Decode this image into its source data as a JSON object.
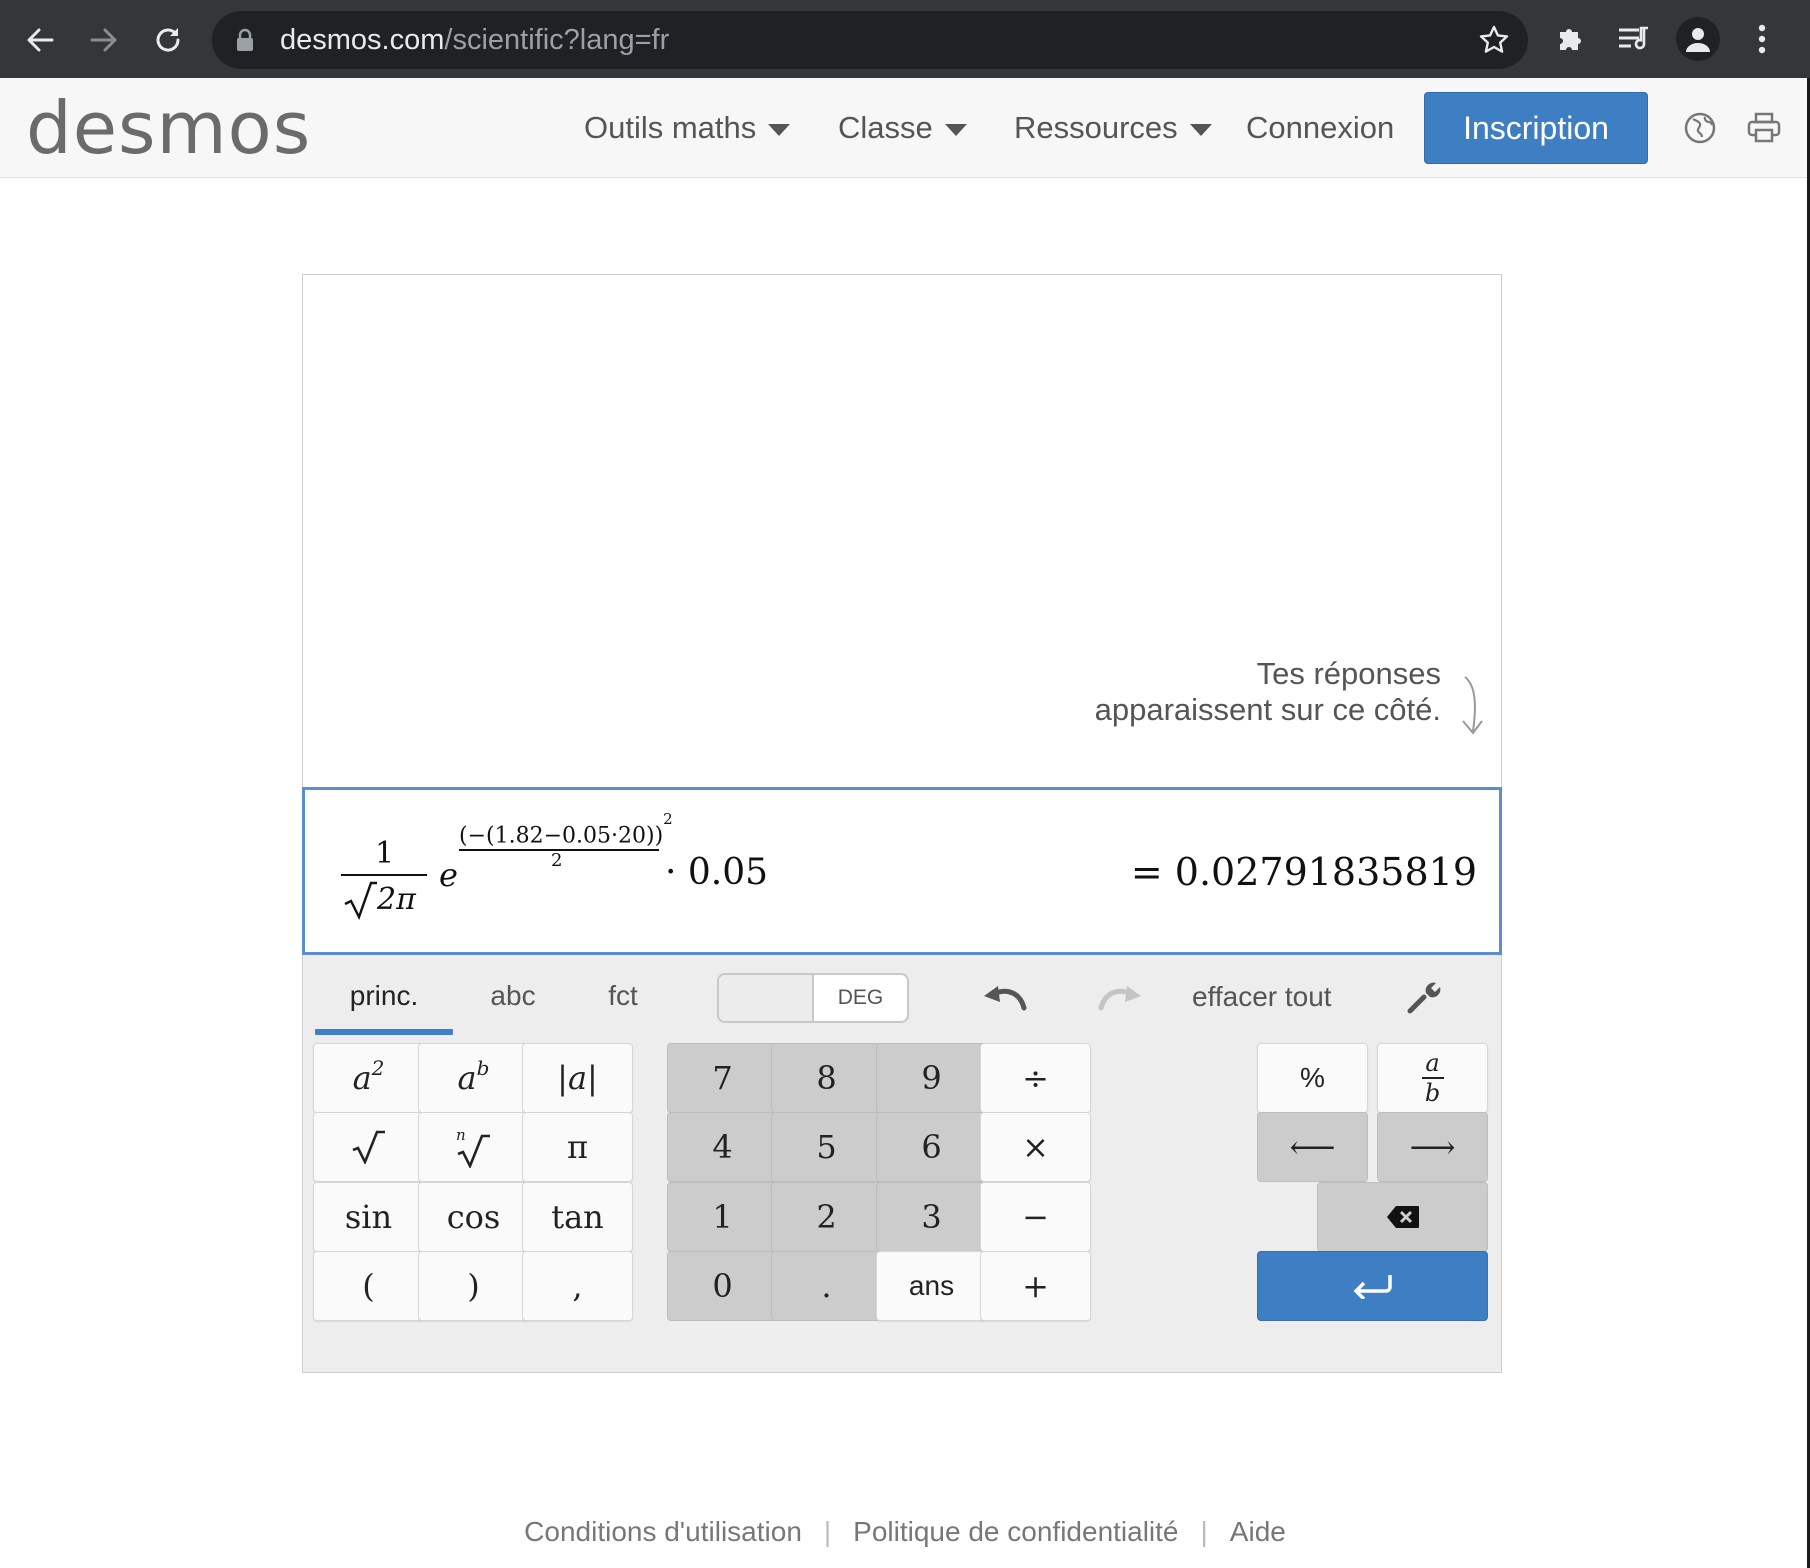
{
  "browser": {
    "url_host": "desmos.com",
    "url_path": "/scientific?lang=fr"
  },
  "header": {
    "logo": "desmos",
    "nav": [
      {
        "label": "Outils maths"
      },
      {
        "label": "Classe"
      },
      {
        "label": "Ressources"
      }
    ],
    "login": "Connexion",
    "signup": "Inscription"
  },
  "history": {
    "hint": "Tes réponses apparaissent sur ce côté."
  },
  "expression": {
    "frac_num": "1",
    "sqrt_arg": "2π",
    "base": "e",
    "exp_num": "(−(1.82−0.05·20))",
    "exp_num_power": "2",
    "exp_den": "2",
    "tail": "· 0.05",
    "answer": "= 0.02791835819"
  },
  "keypad": {
    "tabs": [
      "princ.",
      "abc",
      "fct"
    ],
    "angle_mode": "DEG",
    "clear_all": "effacer tout",
    "func_keys": {
      "abs": "|a|",
      "pi": "π",
      "sin": "sin",
      "cos": "cos",
      "tan": "tan",
      "lparen": "(",
      "rparen": ")",
      "comma": ","
    },
    "num_keys": {
      "k7": "7",
      "k8": "8",
      "k9": "9",
      "div": "÷",
      "k4": "4",
      "k5": "5",
      "k6": "6",
      "mul": "×",
      "k1": "1",
      "k2": "2",
      "k3": "3",
      "sub": "−",
      "k0": "0",
      "dot": ".",
      "ans": "ans",
      "add": "+"
    },
    "right_keys": {
      "percent": "%",
      "left": "⟵",
      "right": "⟶"
    }
  },
  "footer": {
    "terms": "Conditions d'utilisation",
    "privacy": "Politique de confidentialité",
    "help": "Aide"
  },
  "colors": {
    "accent_blue": "#3e7ec2",
    "chrome_dark": "#35363a",
    "expression_border": "#5b8ed1"
  }
}
